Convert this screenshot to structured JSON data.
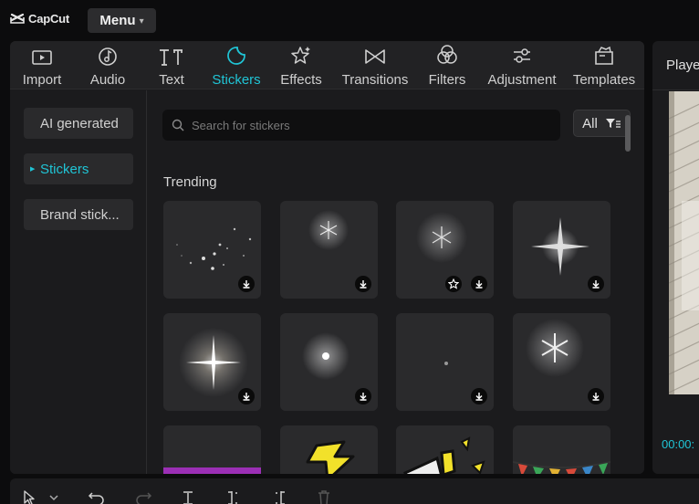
{
  "app": {
    "name": "CapCut",
    "menu_label": "Menu"
  },
  "tabs": [
    {
      "label": "Import",
      "icon": "import-icon"
    },
    {
      "label": "Audio",
      "icon": "audio-icon"
    },
    {
      "label": "Text",
      "icon": "text-icon"
    },
    {
      "label": "Stickers",
      "icon": "stickers-icon",
      "active": true
    },
    {
      "label": "Effects",
      "icon": "effects-icon"
    },
    {
      "label": "Transitions",
      "icon": "transitions-icon"
    },
    {
      "label": "Filters",
      "icon": "filters-icon"
    },
    {
      "label": "Adjustment",
      "icon": "adjustment-icon"
    },
    {
      "label": "Templates",
      "icon": "templates-icon"
    }
  ],
  "sidebar": {
    "items": [
      {
        "label": "AI generated"
      },
      {
        "label": "Stickers",
        "active": true
      },
      {
        "label": "Brand stick..."
      }
    ]
  },
  "search": {
    "placeholder": "Search for stickers",
    "value": ""
  },
  "filter": {
    "label": "All"
  },
  "section": {
    "title": "Trending"
  },
  "stickers": [
    {
      "name": "sparkle-particles",
      "download": true,
      "favorite": false
    },
    {
      "name": "snowflake-glow",
      "download": true,
      "favorite": false
    },
    {
      "name": "snowflake-sparkle",
      "download": true,
      "favorite": true
    },
    {
      "name": "star-flare",
      "download": true,
      "favorite": false
    },
    {
      "name": "big-glow-flare",
      "download": true,
      "favorite": false
    },
    {
      "name": "small-glow-burst",
      "download": true,
      "favorite": false
    },
    {
      "name": "tiny-dot",
      "download": true,
      "favorite": false
    },
    {
      "name": "snowflake-frost",
      "download": true,
      "favorite": false
    },
    {
      "name": "purple-banner",
      "download": false,
      "favorite": false
    },
    {
      "name": "yellow-lightning",
      "download": false,
      "favorite": false
    },
    {
      "name": "megaphone",
      "download": false,
      "favorite": false
    },
    {
      "name": "bunting-flags",
      "download": false,
      "favorite": false
    }
  ],
  "player": {
    "title": "Player",
    "timecode": "00:00:"
  },
  "toolbar": {
    "tools": [
      "select-pointer-icon",
      "chevron-down-icon",
      "undo-icon",
      "redo-icon",
      "split-icon",
      "split-left-icon",
      "split-right-icon",
      "delete-icon"
    ]
  },
  "colors": {
    "accent": "#20c5d6",
    "panel": "#1b1b1d",
    "tile": "#2a2a2c",
    "background": "#0c0c0d"
  }
}
